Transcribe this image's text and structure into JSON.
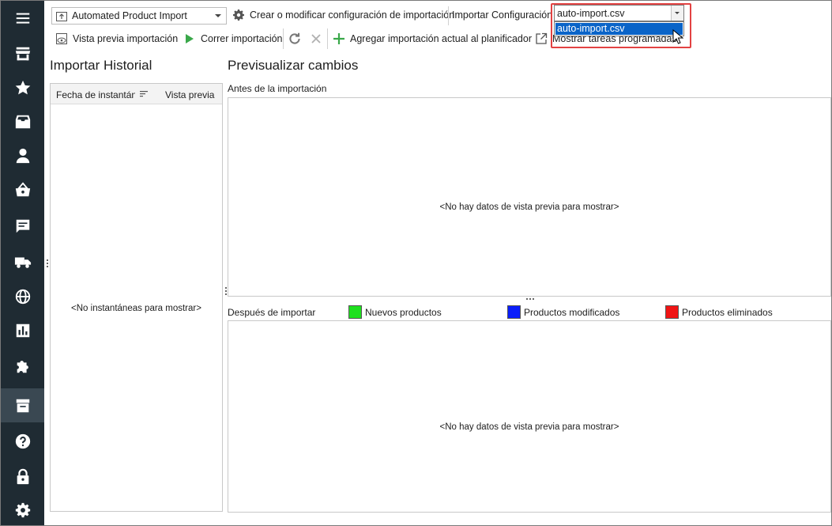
{
  "sidebar": {
    "items": [
      {
        "icon": "menu-icon"
      },
      {
        "icon": "store-icon"
      },
      {
        "icon": "star-icon"
      },
      {
        "icon": "inbox-icon"
      },
      {
        "icon": "user-icon"
      },
      {
        "icon": "basket-icon"
      },
      {
        "icon": "chat-icon"
      },
      {
        "icon": "truck-icon"
      },
      {
        "icon": "globe-icon"
      },
      {
        "icon": "chart-icon"
      },
      {
        "icon": "puzzle-icon"
      },
      {
        "icon": "import-box-icon",
        "active": true
      },
      {
        "icon": "help-icon"
      },
      {
        "icon": "lock-icon"
      },
      {
        "icon": "gear-icon"
      }
    ],
    "bg_color": "#1f2b33"
  },
  "toolbar": {
    "profile_value": "Automated Product Import",
    "create_config_label": "Crear o modificar configuración de importación",
    "import_config_label": "Importar Configuración",
    "import_config_value": "auto-import.csv",
    "dropdown_option": "auto-import.csv",
    "preview_import_label": "Vista previa importación",
    "run_import_label": "Correr importación",
    "add_scheduler_label": "Agregar importación actual al planificador",
    "show_tasks_label": "Mostrar tareas programadas"
  },
  "history": {
    "title": "Importar Historial",
    "columns": [
      "Fecha de instantánea",
      "Vista previa"
    ],
    "empty_text": "<No instantáneas para mostrar>"
  },
  "preview": {
    "title": "Previsualizar cambios",
    "before_label": "Antes de la importación",
    "after_label": "Después de importar",
    "empty_text": "<No hay datos de vista previa para mostrar>",
    "legend": [
      {
        "label": "Nuevos productos",
        "color": "#1ee01e"
      },
      {
        "label": "Productos modificados",
        "color": "#0a1efa"
      },
      {
        "label": "Productos eliminados",
        "color": "#f01414"
      }
    ]
  },
  "colors": {
    "highlight": "#e34242",
    "selection": "#0a64c8",
    "run_green": "#3aa84a",
    "add_green": "#3aa84a"
  }
}
